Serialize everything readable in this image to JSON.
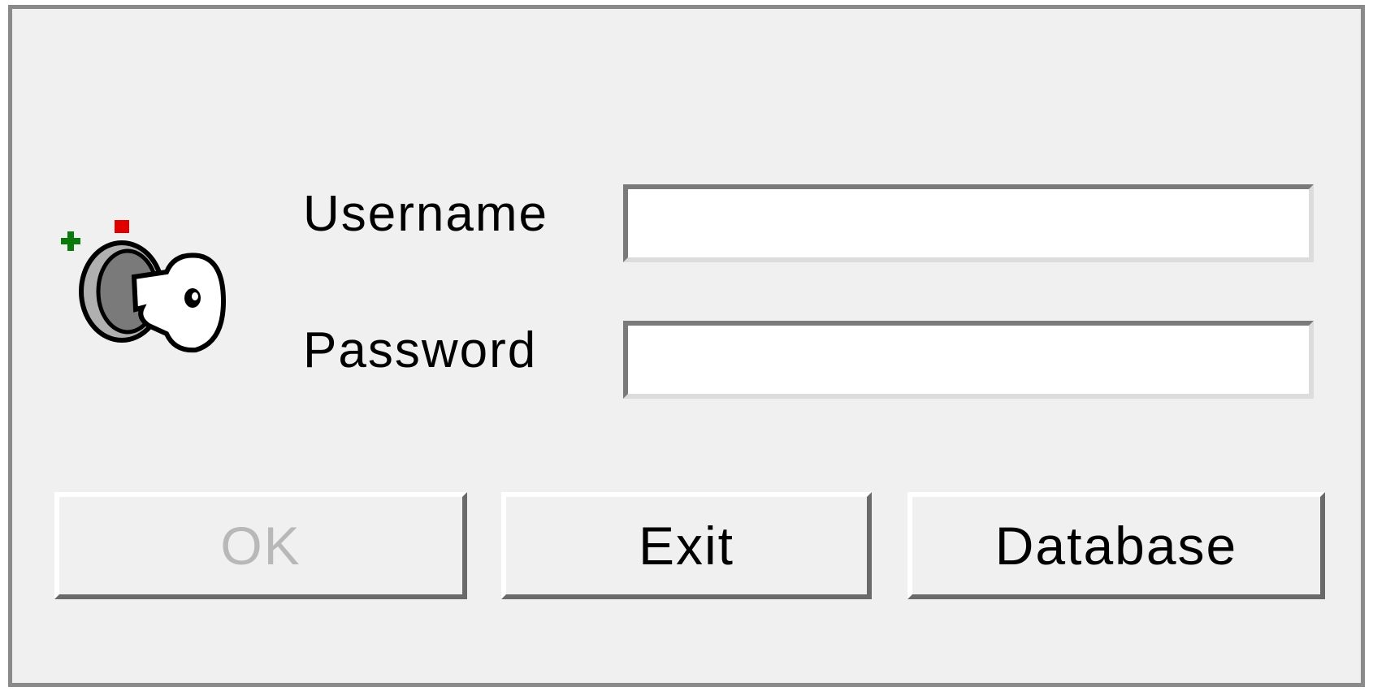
{
  "dialog": {
    "icon": "key-icon",
    "username_label": "Username",
    "password_label": "Password",
    "username_value": "",
    "password_value": ""
  },
  "buttons": {
    "ok_label": "OK",
    "ok_enabled": false,
    "exit_label": "Exit",
    "database_label": "Database"
  },
  "colors": {
    "background": "#f0f0f0",
    "field_background": "#ffffff",
    "disabled_text": "#b8b8b8",
    "icon_red": "#e00000",
    "icon_green": "#0a7a0a"
  }
}
